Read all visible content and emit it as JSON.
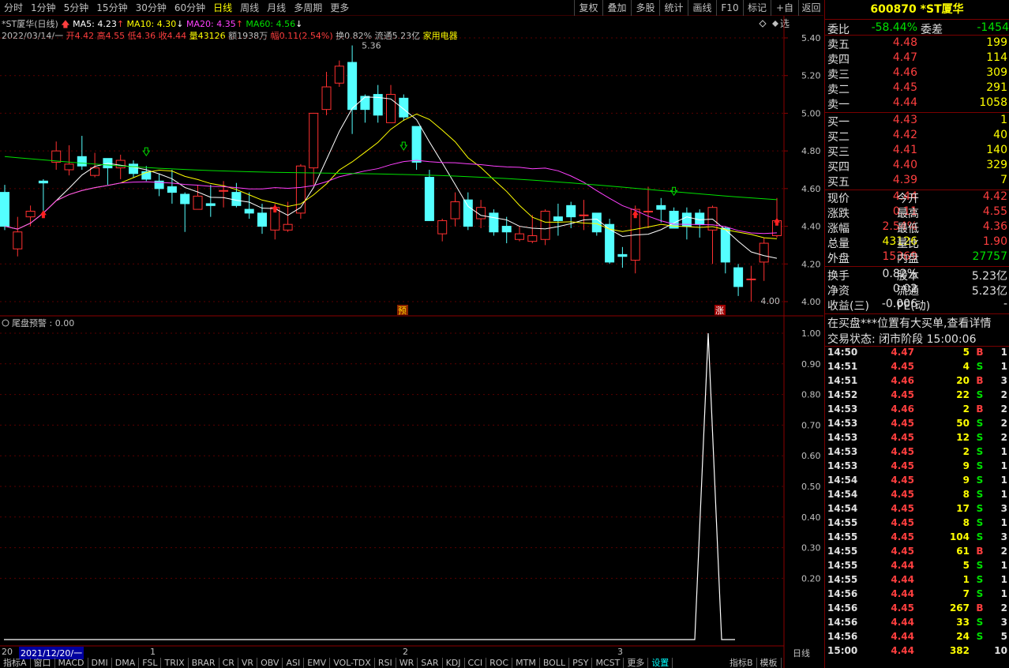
{
  "toolbar": {
    "tabs": [
      "分时",
      "1分钟",
      "5分钟",
      "15分钟",
      "30分钟",
      "60分钟",
      "日线",
      "周线",
      "月线",
      "多周期",
      "更多"
    ],
    "active": "日线",
    "right": [
      "复权",
      "叠加",
      "多股",
      "统计",
      "画线",
      "F10",
      "标记",
      "+自选",
      "返回"
    ]
  },
  "stock": {
    "name": "*ST厦华(日线)",
    "code": "600870",
    "title": "*ST厦华",
    "ma5": "MA5: 4.23",
    "ma10": "MA10: 4.30",
    "ma20": "MA20: 4.35",
    "ma60": "MA60: 4.56",
    "date": "2022/03/14/一",
    "open": "开4.42",
    "high": "高4.55",
    "low": "低4.36",
    "close": "收4.44",
    "vol": "量43126",
    "amt": "额1938万",
    "amp": "幅0.11(2.54%)",
    "turnover": "换0.82%",
    "float": "流通5.23亿",
    "industry": "家用电器"
  },
  "price_axis": [
    "5.40",
    "5.20",
    "5.00",
    "4.80",
    "4.60",
    "4.40",
    "4.20",
    "4.00"
  ],
  "ind_axis": [
    "1.00",
    "0.90",
    "0.80",
    "0.70",
    "0.60",
    "0.50",
    "0.40",
    "0.30",
    "0.20"
  ],
  "annotations": {
    "high": "5.36",
    "low": "4.00",
    "pre": "预",
    "up": "涨"
  },
  "indicator": {
    "label": "尾盘预警 : 0.00"
  },
  "chart_data": {
    "type": "candlestick",
    "candles": [
      [
        4.58,
        4.4,
        4.62,
        4.38
      ],
      [
        4.28,
        4.37,
        4.45,
        4.24
      ],
      [
        4.45,
        4.48,
        4.51,
        4.4
      ],
      [
        4.64,
        4.63,
        4.65,
        4.45
      ],
      [
        4.74,
        4.8,
        4.85,
        4.7
      ],
      [
        4.7,
        4.73,
        4.83,
        4.67
      ],
      [
        4.77,
        4.72,
        4.88,
        4.7
      ],
      [
        4.67,
        4.71,
        4.79,
        4.66
      ],
      [
        4.76,
        4.71,
        4.74,
        4.62
      ],
      [
        4.71,
        4.75,
        4.78,
        4.65
      ],
      [
        4.73,
        4.68,
        4.75,
        4.66
      ],
      [
        4.69,
        4.65,
        4.72,
        4.64
      ],
      [
        4.64,
        4.6,
        4.68,
        4.56
      ],
      [
        4.61,
        4.58,
        4.7,
        4.52
      ],
      [
        4.57,
        4.52,
        4.58,
        4.37
      ],
      [
        4.49,
        4.56,
        4.62,
        4.49
      ],
      [
        4.52,
        4.51,
        4.62,
        4.45
      ],
      [
        4.59,
        4.59,
        4.64,
        4.5
      ],
      [
        4.58,
        4.51,
        4.63,
        4.5
      ],
      [
        4.49,
        4.47,
        4.58,
        4.44
      ],
      [
        4.47,
        4.4,
        4.52,
        4.36
      ],
      [
        4.38,
        4.5,
        4.52,
        4.33
      ],
      [
        4.38,
        4.41,
        4.53,
        4.37
      ],
      [
        4.47,
        4.72,
        4.73,
        4.44
      ],
      [
        4.71,
        5.0,
        5.0,
        4.62
      ],
      [
        5.02,
        5.14,
        5.22,
        4.99
      ],
      [
        5.16,
        5.25,
        5.28,
        5.14
      ],
      [
        5.27,
        5.02,
        5.36,
        4.89
      ],
      [
        5.09,
        5.02,
        5.1,
        4.95
      ],
      [
        5.1,
        4.99,
        5.15,
        4.95
      ],
      [
        4.95,
        5.1,
        5.15,
        4.95
      ],
      [
        5.08,
        4.98,
        5.1,
        4.96
      ],
      [
        4.93,
        4.74,
        4.93,
        4.7
      ],
      [
        4.66,
        4.43,
        4.7,
        4.43
      ],
      [
        4.36,
        4.43,
        4.44,
        4.32
      ],
      [
        4.44,
        4.53,
        4.58,
        4.4
      ],
      [
        4.54,
        4.4,
        4.58,
        4.38
      ],
      [
        4.44,
        4.5,
        4.54,
        4.39
      ],
      [
        4.47,
        4.37,
        4.49,
        4.35
      ],
      [
        4.4,
        4.37,
        4.45,
        4.31
      ],
      [
        4.33,
        4.36,
        4.4,
        4.32
      ],
      [
        4.32,
        4.35,
        4.46,
        4.31
      ],
      [
        4.33,
        4.48,
        4.49,
        4.3
      ],
      [
        4.45,
        4.43,
        4.52,
        4.35
      ],
      [
        4.51,
        4.45,
        4.53,
        4.39
      ],
      [
        4.46,
        4.46,
        4.54,
        4.38
      ],
      [
        4.47,
        4.37,
        4.47,
        4.35
      ],
      [
        4.41,
        4.21,
        4.44,
        4.2
      ],
      [
        4.25,
        4.24,
        4.29,
        4.18
      ],
      [
        4.22,
        4.49,
        4.51,
        4.15
      ],
      [
        4.48,
        4.48,
        4.61,
        4.39
      ],
      [
        4.51,
        4.49,
        4.55,
        4.42
      ],
      [
        4.48,
        4.39,
        4.5,
        4.39
      ],
      [
        4.47,
        4.4,
        4.5,
        4.33
      ],
      [
        4.47,
        4.41,
        4.49,
        4.34
      ],
      [
        4.38,
        4.5,
        4.51,
        4.2
      ],
      [
        4.39,
        4.21,
        4.4,
        4.15
      ],
      [
        4.18,
        4.08,
        4.2,
        4.03
      ],
      [
        4.12,
        4.12,
        4.19,
        4.0
      ],
      [
        4.21,
        4.31,
        4.34,
        4.11
      ],
      [
        4.35,
        4.43,
        4.55,
        4.34
      ]
    ],
    "ylim": [
      4.0,
      5.4
    ]
  },
  "quote": {
    "webi": [
      "委比",
      "-58.44%",
      "委差",
      "-1454"
    ],
    "sell": [
      [
        "卖五",
        "4.48",
        "199"
      ],
      [
        "卖四",
        "4.47",
        "114"
      ],
      [
        "卖三",
        "4.46",
        "309"
      ],
      [
        "卖二",
        "4.45",
        "291"
      ],
      [
        "卖一",
        "4.44",
        "1058"
      ]
    ],
    "buy": [
      [
        "买一",
        "4.43",
        "1"
      ],
      [
        "买二",
        "4.42",
        "40"
      ],
      [
        "买三",
        "4.41",
        "140"
      ],
      [
        "买四",
        "4.40",
        "329"
      ],
      [
        "买五",
        "4.39",
        "7"
      ]
    ],
    "stats": [
      [
        "现价",
        "4.44",
        "今开",
        "4.42"
      ],
      [
        "涨跌",
        "0.11",
        "最高",
        "4.55"
      ],
      [
        "涨幅",
        "2.54%",
        "最低",
        "4.36"
      ],
      [
        "总量",
        "43126",
        "量比",
        "1.90"
      ],
      [
        "外盘",
        "15369",
        "内盘",
        "27757"
      ]
    ],
    "stats2": [
      [
        "换手",
        "0.82%",
        "股本",
        "5.23亿"
      ],
      [
        "净资",
        "0.02",
        "流通",
        "5.23亿"
      ],
      [
        "收益(三)",
        "-0.006",
        "PE(动)",
        "-"
      ]
    ],
    "notice": "在买盘***位置有大买单,查看详情",
    "status": "交易状态: 闭市阶段 15:00:06"
  },
  "ticks": [
    [
      "14:50",
      "4.47",
      "5",
      "B",
      "1"
    ],
    [
      "14:51",
      "4.45",
      "4",
      "S",
      "1"
    ],
    [
      "14:51",
      "4.46",
      "20",
      "B",
      "3"
    ],
    [
      "14:52",
      "4.45",
      "22",
      "S",
      "2"
    ],
    [
      "14:53",
      "4.46",
      "2",
      "B",
      "2"
    ],
    [
      "14:53",
      "4.45",
      "50",
      "S",
      "2"
    ],
    [
      "14:53",
      "4.45",
      "12",
      "S",
      "2"
    ],
    [
      "14:53",
      "4.45",
      "2",
      "S",
      "1"
    ],
    [
      "14:53",
      "4.45",
      "9",
      "S",
      "1"
    ],
    [
      "14:54",
      "4.45",
      "9",
      "S",
      "1"
    ],
    [
      "14:54",
      "4.45",
      "8",
      "S",
      "1"
    ],
    [
      "14:54",
      "4.45",
      "17",
      "S",
      "3"
    ],
    [
      "14:55",
      "4.45",
      "8",
      "S",
      "1"
    ],
    [
      "14:55",
      "4.45",
      "104",
      "S",
      "3"
    ],
    [
      "14:55",
      "4.45",
      "61",
      "B",
      "2"
    ],
    [
      "14:55",
      "4.44",
      "5",
      "S",
      "1"
    ],
    [
      "14:55",
      "4.44",
      "1",
      "S",
      "1"
    ],
    [
      "14:56",
      "4.44",
      "7",
      "S",
      "1"
    ],
    [
      "14:56",
      "4.45",
      "267",
      "B",
      "2"
    ],
    [
      "14:56",
      "4.44",
      "33",
      "S",
      "3"
    ],
    [
      "14:56",
      "4.44",
      "24",
      "S",
      "5"
    ],
    [
      "15:00",
      "4.44",
      "382",
      "",
      "10"
    ]
  ],
  "bottom": {
    "date": "2021/12/20/一",
    "months": [
      "1",
      "2",
      "3"
    ],
    "period": "日线",
    "tabs": [
      "指标A",
      "窗口",
      "MACD",
      "DMI",
      "DMA",
      "FSL",
      "TRIX",
      "BRAR",
      "CR",
      "VR",
      "OBV",
      "ASI",
      "EMV",
      "VOL-TDX",
      "RSI",
      "WR",
      "SAR",
      "KDJ",
      "CCI",
      "ROC",
      "MTM",
      "BOLL",
      "PSY",
      "MCST",
      "更多",
      "设置"
    ],
    "right": [
      "指标B",
      "模板"
    ],
    "year": "20"
  }
}
